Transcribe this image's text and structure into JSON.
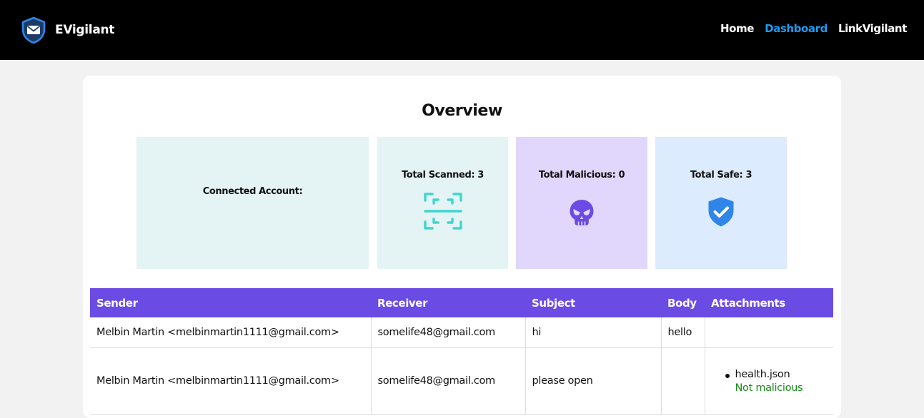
{
  "app": {
    "name": "EVigilant"
  },
  "nav": [
    {
      "label": "Home",
      "active": false
    },
    {
      "label": "Dashboard",
      "active": true
    },
    {
      "label": "LinkVigilant",
      "active": false
    }
  ],
  "overview": {
    "title": "Overview",
    "stats": {
      "account": "Connected Account:",
      "scanned": "Total Scanned: 3",
      "malicious": "Total Malicious: 0",
      "safe": "Total Safe: 3"
    },
    "icons": {
      "brand": "shield-envelope-icon",
      "scanned": "scan-icon",
      "malicious": "skull-icon",
      "safe": "shield-check-icon"
    }
  },
  "table": {
    "headers": [
      "Sender",
      "Receiver",
      "Subject",
      "Body",
      "Attachments"
    ],
    "rows": [
      {
        "sender": "Melbin Martin <melbinmartin1111@gmail.com>",
        "receiver": "somelife48@gmail.com",
        "subject": "hi",
        "body": "hello",
        "attachments": []
      },
      {
        "sender": "Melbin Martin <melbinmartin1111@gmail.com>",
        "receiver": "somelife48@gmail.com",
        "subject": "please open",
        "body": "",
        "attachments": [
          {
            "name": "health.json",
            "status": "Not malicious"
          }
        ]
      }
    ]
  },
  "colors": {
    "header_bg": "#000000",
    "nav_active": "#1e9bf0",
    "table_header": "#6a4be3",
    "scanned_bg": "#e4f4f4",
    "malicious_bg": "#e1d6fb",
    "safe_bg": "#dcebfe",
    "safe_status": "#1a8a1a"
  }
}
